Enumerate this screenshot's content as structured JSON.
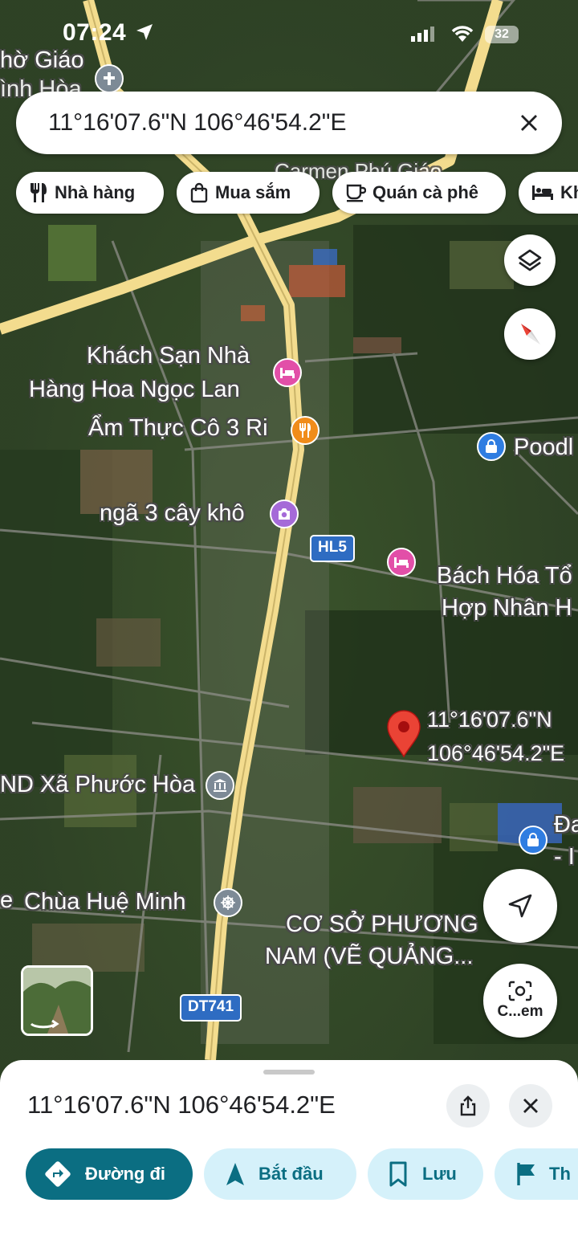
{
  "status_bar": {
    "time": "07:24",
    "battery": "32"
  },
  "search": {
    "value": "11°16'07.6\"N 106°46'54.2\"E"
  },
  "chips": [
    {
      "label": "Nhà hàng",
      "icon": "restaurant-icon"
    },
    {
      "label": "Mua sắm",
      "icon": "shopping-bag-icon"
    },
    {
      "label": "Quán cà phê",
      "icon": "coffee-icon"
    },
    {
      "label": "Kh",
      "icon": "hotel-icon"
    }
  ],
  "map": {
    "labels": {
      "top_left_1": "hờ Giáo",
      "top_left_2": "ình Hòa",
      "top_faded": "Carmen Phú Giáo",
      "hotel_line1": "Khách Sạn Nhà",
      "hotel_line2": "Hàng Hoa Ngọc Lan",
      "food": "Ẩm Thực Cô 3 Ri",
      "poodle": "Poodl",
      "junction": "ngã 3 cây khô",
      "store_line1": "Bách Hóa Tổ",
      "store_line2": "Hợp Nhân H",
      "pin_line1": "11°16'07.6\"N",
      "pin_line2": "106°46'54.2\"E",
      "commune": "ND Xã Phước Hòa",
      "right_da_1": "Đa",
      "right_da_2": "- I",
      "pagoda": "Chùa Huệ Minh",
      "pagoda_prefix": "e",
      "phuongnam_line1": "CƠ SỞ PHƯƠNG",
      "phuongnam_line2": "NAM (VẼ QUẢNG..."
    },
    "road_shields": {
      "hl5": "HL5",
      "dt741": "DT741"
    },
    "camera_button_label": "C...em",
    "colors": {
      "road": "#f3dc8e",
      "pin_red": "#ea4335",
      "lodging_pink": "#e24fa8",
      "food_orange": "#f08c1a",
      "shop_blue": "#2f7de1",
      "attraction_purple": "#a56ad8"
    }
  },
  "sheet": {
    "coords": "11°16'07.6\"N 106°46'54.2\"E",
    "buttons": [
      {
        "label": "Đường đi",
        "icon": "directions-icon"
      },
      {
        "label": "Bắt đầu",
        "icon": "navigation-arrow-icon"
      },
      {
        "label": "Lưu",
        "icon": "bookmark-icon"
      },
      {
        "label": "Th",
        "icon": "flag-icon"
      }
    ],
    "accent": "#0b6e82",
    "pill_bg": "#d5f1fa"
  }
}
